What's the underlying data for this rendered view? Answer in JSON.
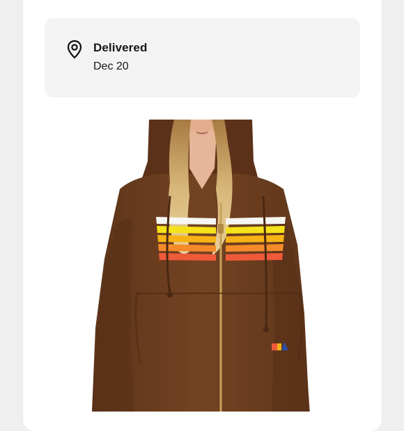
{
  "delivery": {
    "icon": "location-pin-icon",
    "status": "Delivered",
    "date": "Dec 20"
  },
  "product_image": {
    "subject": "brown zip hoodie with rainbow stripes",
    "colors": {
      "hoodie": "#6e3f1f",
      "stripes": [
        "#f6f6f2",
        "#f6e21a",
        "#f7b316",
        "#f48a2a",
        "#ef5a3a"
      ]
    }
  }
}
